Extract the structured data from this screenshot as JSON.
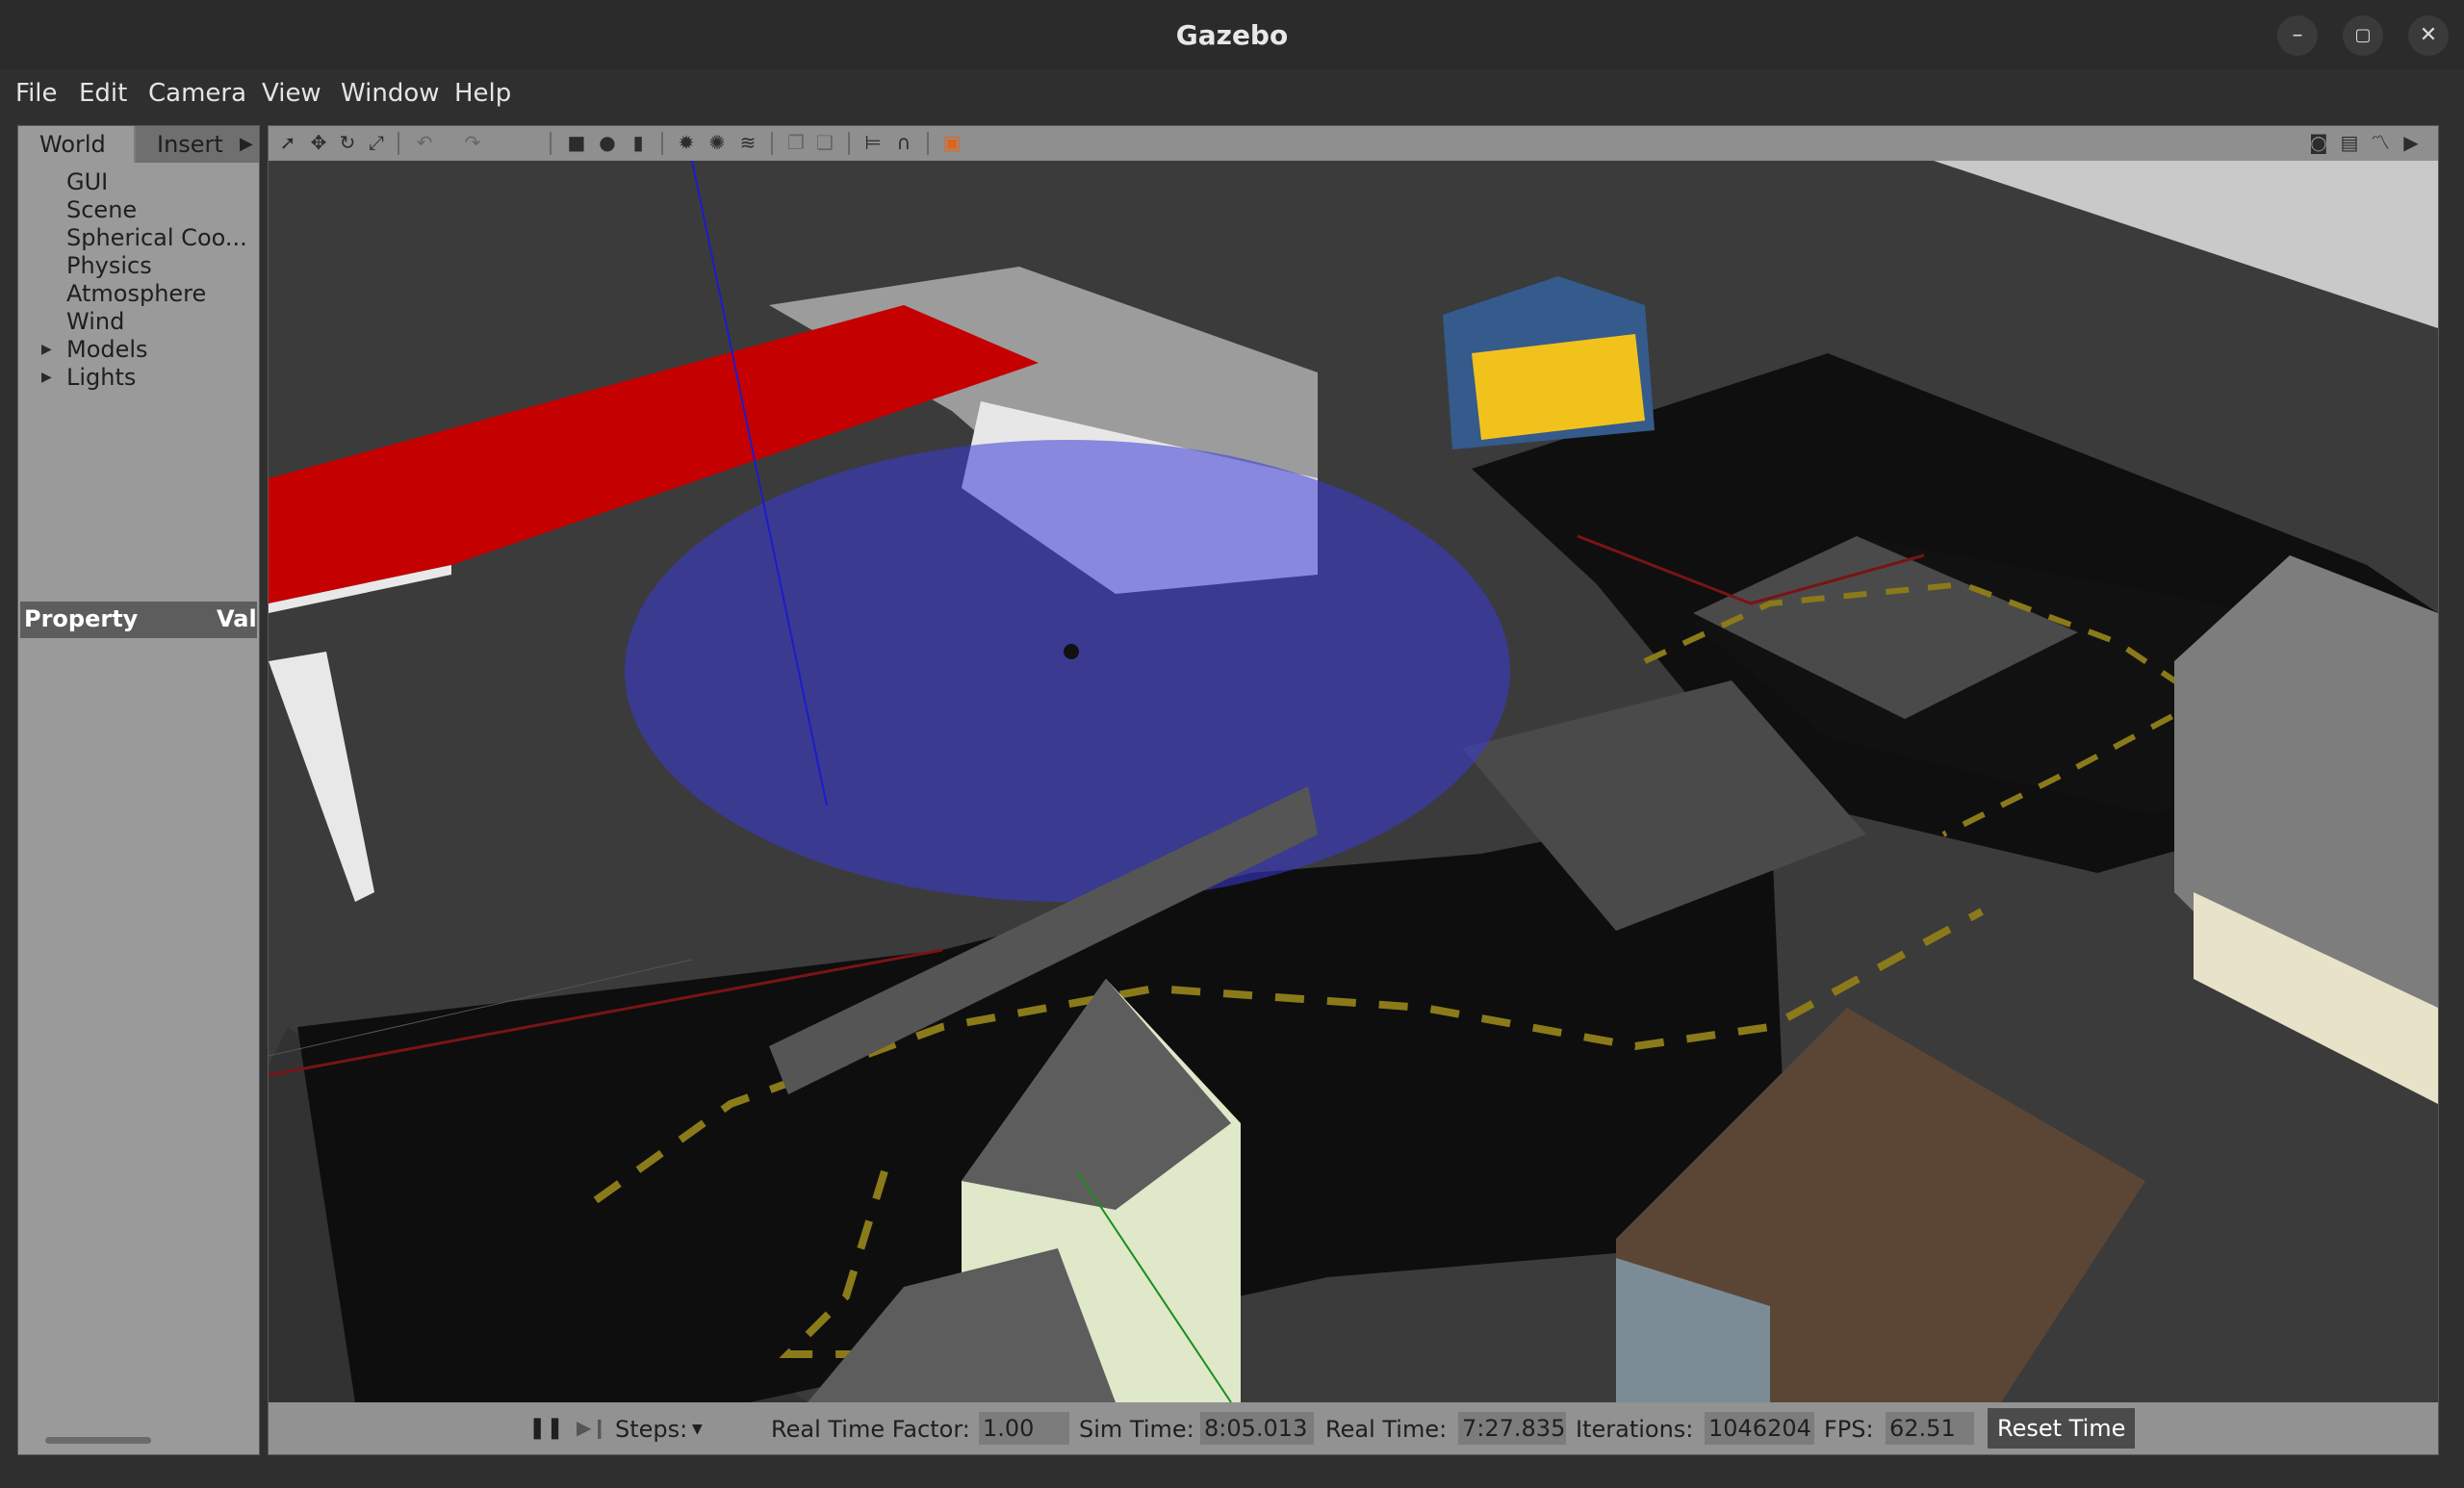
{
  "window": {
    "title": "Gazebo",
    "minimize": "–",
    "maximize": "▢",
    "close": "✕"
  },
  "menu": [
    "File",
    "Edit",
    "Camera",
    "View",
    "Window",
    "Help"
  ],
  "left_panel": {
    "tabs": [
      "World",
      "Insert"
    ],
    "tree": [
      "GUI",
      "Scene",
      "Spherical Coo...",
      "Physics",
      "Atmosphere",
      "Wind",
      "Models",
      "Lights"
    ],
    "property_header": "Property",
    "value_header": "Val"
  },
  "status": {
    "steps_label": "Steps:",
    "rtf_label": "Real Time Factor:",
    "rtf_value": "1.00",
    "sim_label": "Sim Time:",
    "sim_value": "8:05.013",
    "real_label": "Real Time:",
    "real_value": "7:27.835",
    "iter_label": "Iterations:",
    "iter_value": "1046204",
    "fps_label": "FPS:",
    "fps_value": "62.51",
    "reset_label": "Reset Time"
  }
}
